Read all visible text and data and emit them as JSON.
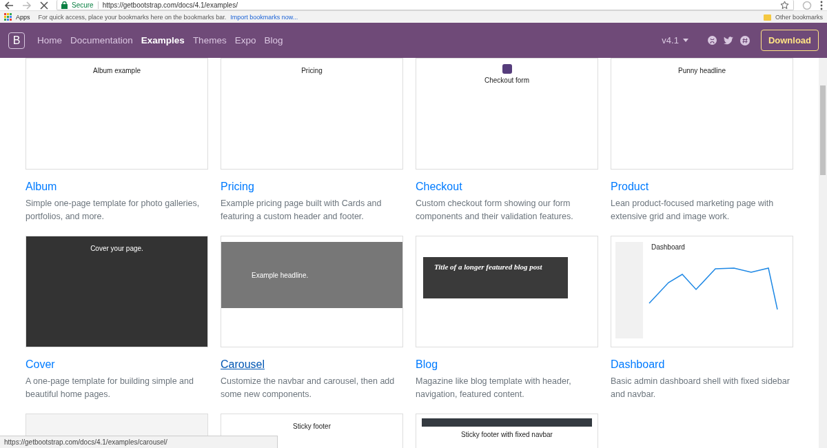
{
  "browser": {
    "secure_label": "Secure",
    "url": "https://getbootstrap.com/docs/4.1/examples/",
    "forward_disabled": true
  },
  "bookmarks_bar": {
    "apps_label": "Apps",
    "hint": "For quick access, place your bookmarks here on the bookmarks bar.",
    "import_link": "Import bookmarks now...",
    "other": "Other bookmarks"
  },
  "navbar": {
    "brand": "B",
    "items": [
      {
        "label": "Home",
        "selected": false
      },
      {
        "label": "Documentation",
        "selected": false
      },
      {
        "label": "Examples",
        "selected": true
      },
      {
        "label": "Themes",
        "selected": false
      },
      {
        "label": "Expo",
        "selected": false
      },
      {
        "label": "Blog",
        "selected": false
      }
    ],
    "version": "v4.1",
    "download": "Download"
  },
  "examples": [
    {
      "title": "Album",
      "description": "Simple one-page template for photo galleries, portfolios, and more.",
      "hovered": false,
      "preview": {
        "kind": "light",
        "headline": "Album example"
      }
    },
    {
      "title": "Pricing",
      "description": "Example pricing page built with Cards and featuring a custom header and footer.",
      "hovered": false,
      "preview": {
        "kind": "light",
        "headline": "Pricing"
      }
    },
    {
      "title": "Checkout",
      "description": "Custom checkout form showing our form components and their validation features.",
      "hovered": false,
      "preview": {
        "kind": "form",
        "headline": "Checkout form"
      }
    },
    {
      "title": "Product",
      "description": "Lean product-focused marketing page with extensive grid and image work.",
      "hovered": false,
      "preview": {
        "kind": "light",
        "headline": "Punny headline"
      }
    },
    {
      "title": "Cover",
      "description": "A one-page template for building simple and beautiful home pages.",
      "hovered": false,
      "preview": {
        "kind": "dark",
        "headline": "Cover your page."
      }
    },
    {
      "title": "Carousel",
      "description": "Customize the navbar and carousel, then add some new components.",
      "hovered": true,
      "preview": {
        "kind": "gray",
        "headline": "Example headline."
      }
    },
    {
      "title": "Blog",
      "description": "Magazine like blog template with header, navigation, featured content.",
      "hovered": false,
      "preview": {
        "kind": "blog",
        "headline": "Title of a longer featured blog post"
      }
    },
    {
      "title": "Dashboard",
      "description": "Basic admin dashboard shell with fixed sidebar and navbar.",
      "hovered": false,
      "preview": {
        "kind": "chart",
        "headline": "Dashboard"
      }
    },
    {
      "preview": {
        "kind": "blank"
      }
    },
    {
      "preview": {
        "kind": "light",
        "headline": "Sticky footer"
      }
    },
    {
      "preview": {
        "kind": "navbar",
        "headline": "Sticky footer with fixed navbar"
      }
    }
  ],
  "status_url": "https://getbootstrap.com/docs/4.1/examples/carousel/"
}
